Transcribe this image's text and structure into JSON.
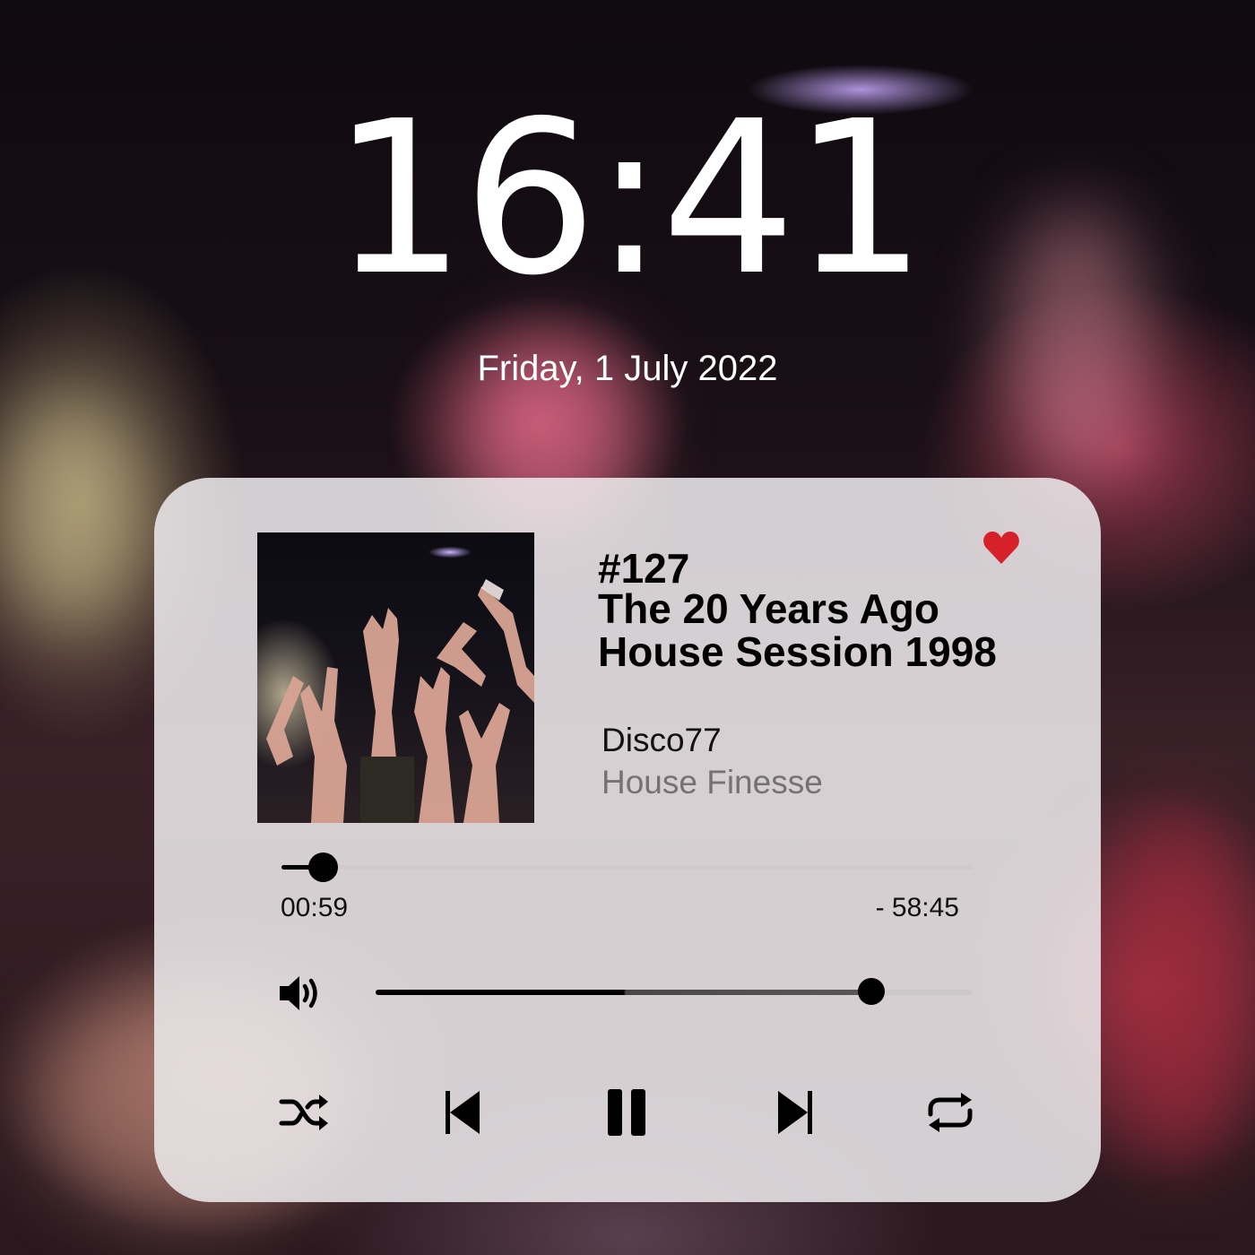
{
  "lockscreen": {
    "time": "16:41",
    "date": "Friday, 1 July 2022"
  },
  "player": {
    "episode": "#127",
    "title": "The 20 Years Ago House Session 1998",
    "artist": "Disco77",
    "album": "House Finesse",
    "liked": true,
    "elapsed": "00:59",
    "remaining": "- 58:45",
    "progress_fraction": 0.06,
    "volume_fraction": 0.83,
    "state": "playing",
    "controls": [
      "shuffle-icon",
      "previous-icon",
      "pause-icon",
      "next-icon",
      "repeat-icon"
    ]
  },
  "colors": {
    "heart": "#d6202a",
    "secondary_text": "#767274"
  }
}
